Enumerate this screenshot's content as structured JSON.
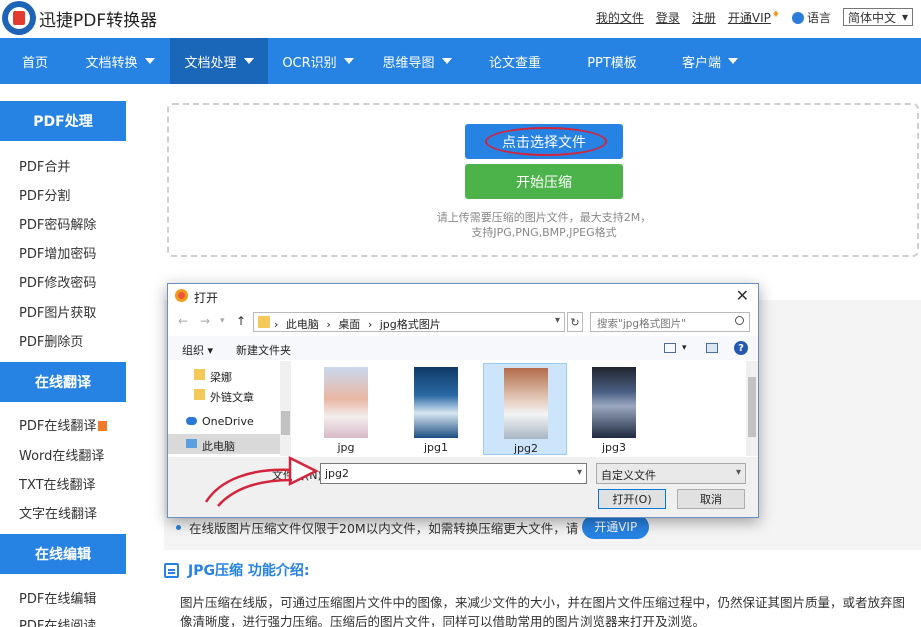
{
  "header": {
    "brand": "迅捷PDF转换器",
    "links": [
      "我的文件",
      "登录",
      "注册",
      "开通VIP"
    ],
    "language_label": "语言",
    "language_value": "简体中文"
  },
  "nav": {
    "items": [
      {
        "label": "首页",
        "dropdown": false
      },
      {
        "label": "文档转换",
        "dropdown": true
      },
      {
        "label": "文档处理",
        "dropdown": true,
        "active": true
      },
      {
        "label": "OCR识别",
        "dropdown": true
      },
      {
        "label": "思维导图",
        "dropdown": true
      },
      {
        "label": "论文查重",
        "dropdown": false
      },
      {
        "label": "PPT模板",
        "dropdown": false
      },
      {
        "label": "客户端",
        "dropdown": true
      }
    ]
  },
  "sidebar": {
    "sections": [
      {
        "title": "PDF处理",
        "items": [
          "PDF合并",
          "PDF分割",
          "PDF密码解除",
          "PDF增加密码",
          "PDF修改密码",
          "PDF图片获取",
          "PDF删除页"
        ]
      },
      {
        "title": "在线翻译",
        "items": [
          "PDF在线翻译",
          "Word在线翻译",
          "TXT在线翻译",
          "文字在线翻译"
        ]
      },
      {
        "title": "在线编辑",
        "items": [
          "PDF在线编辑",
          "PDF在线阅读"
        ]
      }
    ]
  },
  "upload": {
    "select_label": "点击选择文件",
    "start_label": "开始压缩",
    "hint_line1": "请上传需要压缩的图片文件，最大支持2M，",
    "hint_line2": "支持JPG,PNG,BMP,JPEG格式"
  },
  "notice": {
    "text": "在线版图片压缩文件仅限于20M以内文件，如需转换压缩更大文件，请",
    "vip_button": "开通VIP"
  },
  "intro": {
    "title": "JPG压缩 功能介绍:",
    "line1": "图片压缩在线版，可通过压缩图片文件中的图像，来减少文件的大小，并在图片文件压缩过程中，仍然保证其图片质量，或者放弃图",
    "line2": "像清晰度，进行强力压缩。压缩后的图片文件，同样可以借助常用的图片浏览器来打开及浏览。"
  },
  "dialog": {
    "title": "打开",
    "path": [
      "此电脑",
      "桌面",
      "jpg格式图片"
    ],
    "search_placeholder": "搜索\"jpg格式图片\"",
    "organize": "组织 ▾",
    "new_folder": "新建文件夹",
    "nav_items": [
      "梁娜",
      "外链文章",
      "OneDrive",
      "此电脑"
    ],
    "files": [
      "jpg",
      "jpg1",
      "jpg2",
      "jpg3"
    ],
    "selected_file": "jpg2",
    "filename_label": "文件名(N):",
    "filename_value": "jpg2",
    "filetype_value": "自定义文件",
    "open_button": "打开(O)",
    "cancel_button": "取消"
  },
  "colors": {
    "brand_blue": "#2783e3",
    "nav_active": "#1a66b8",
    "start_green": "#4cb34b",
    "annotation_red": "#d4243c"
  }
}
